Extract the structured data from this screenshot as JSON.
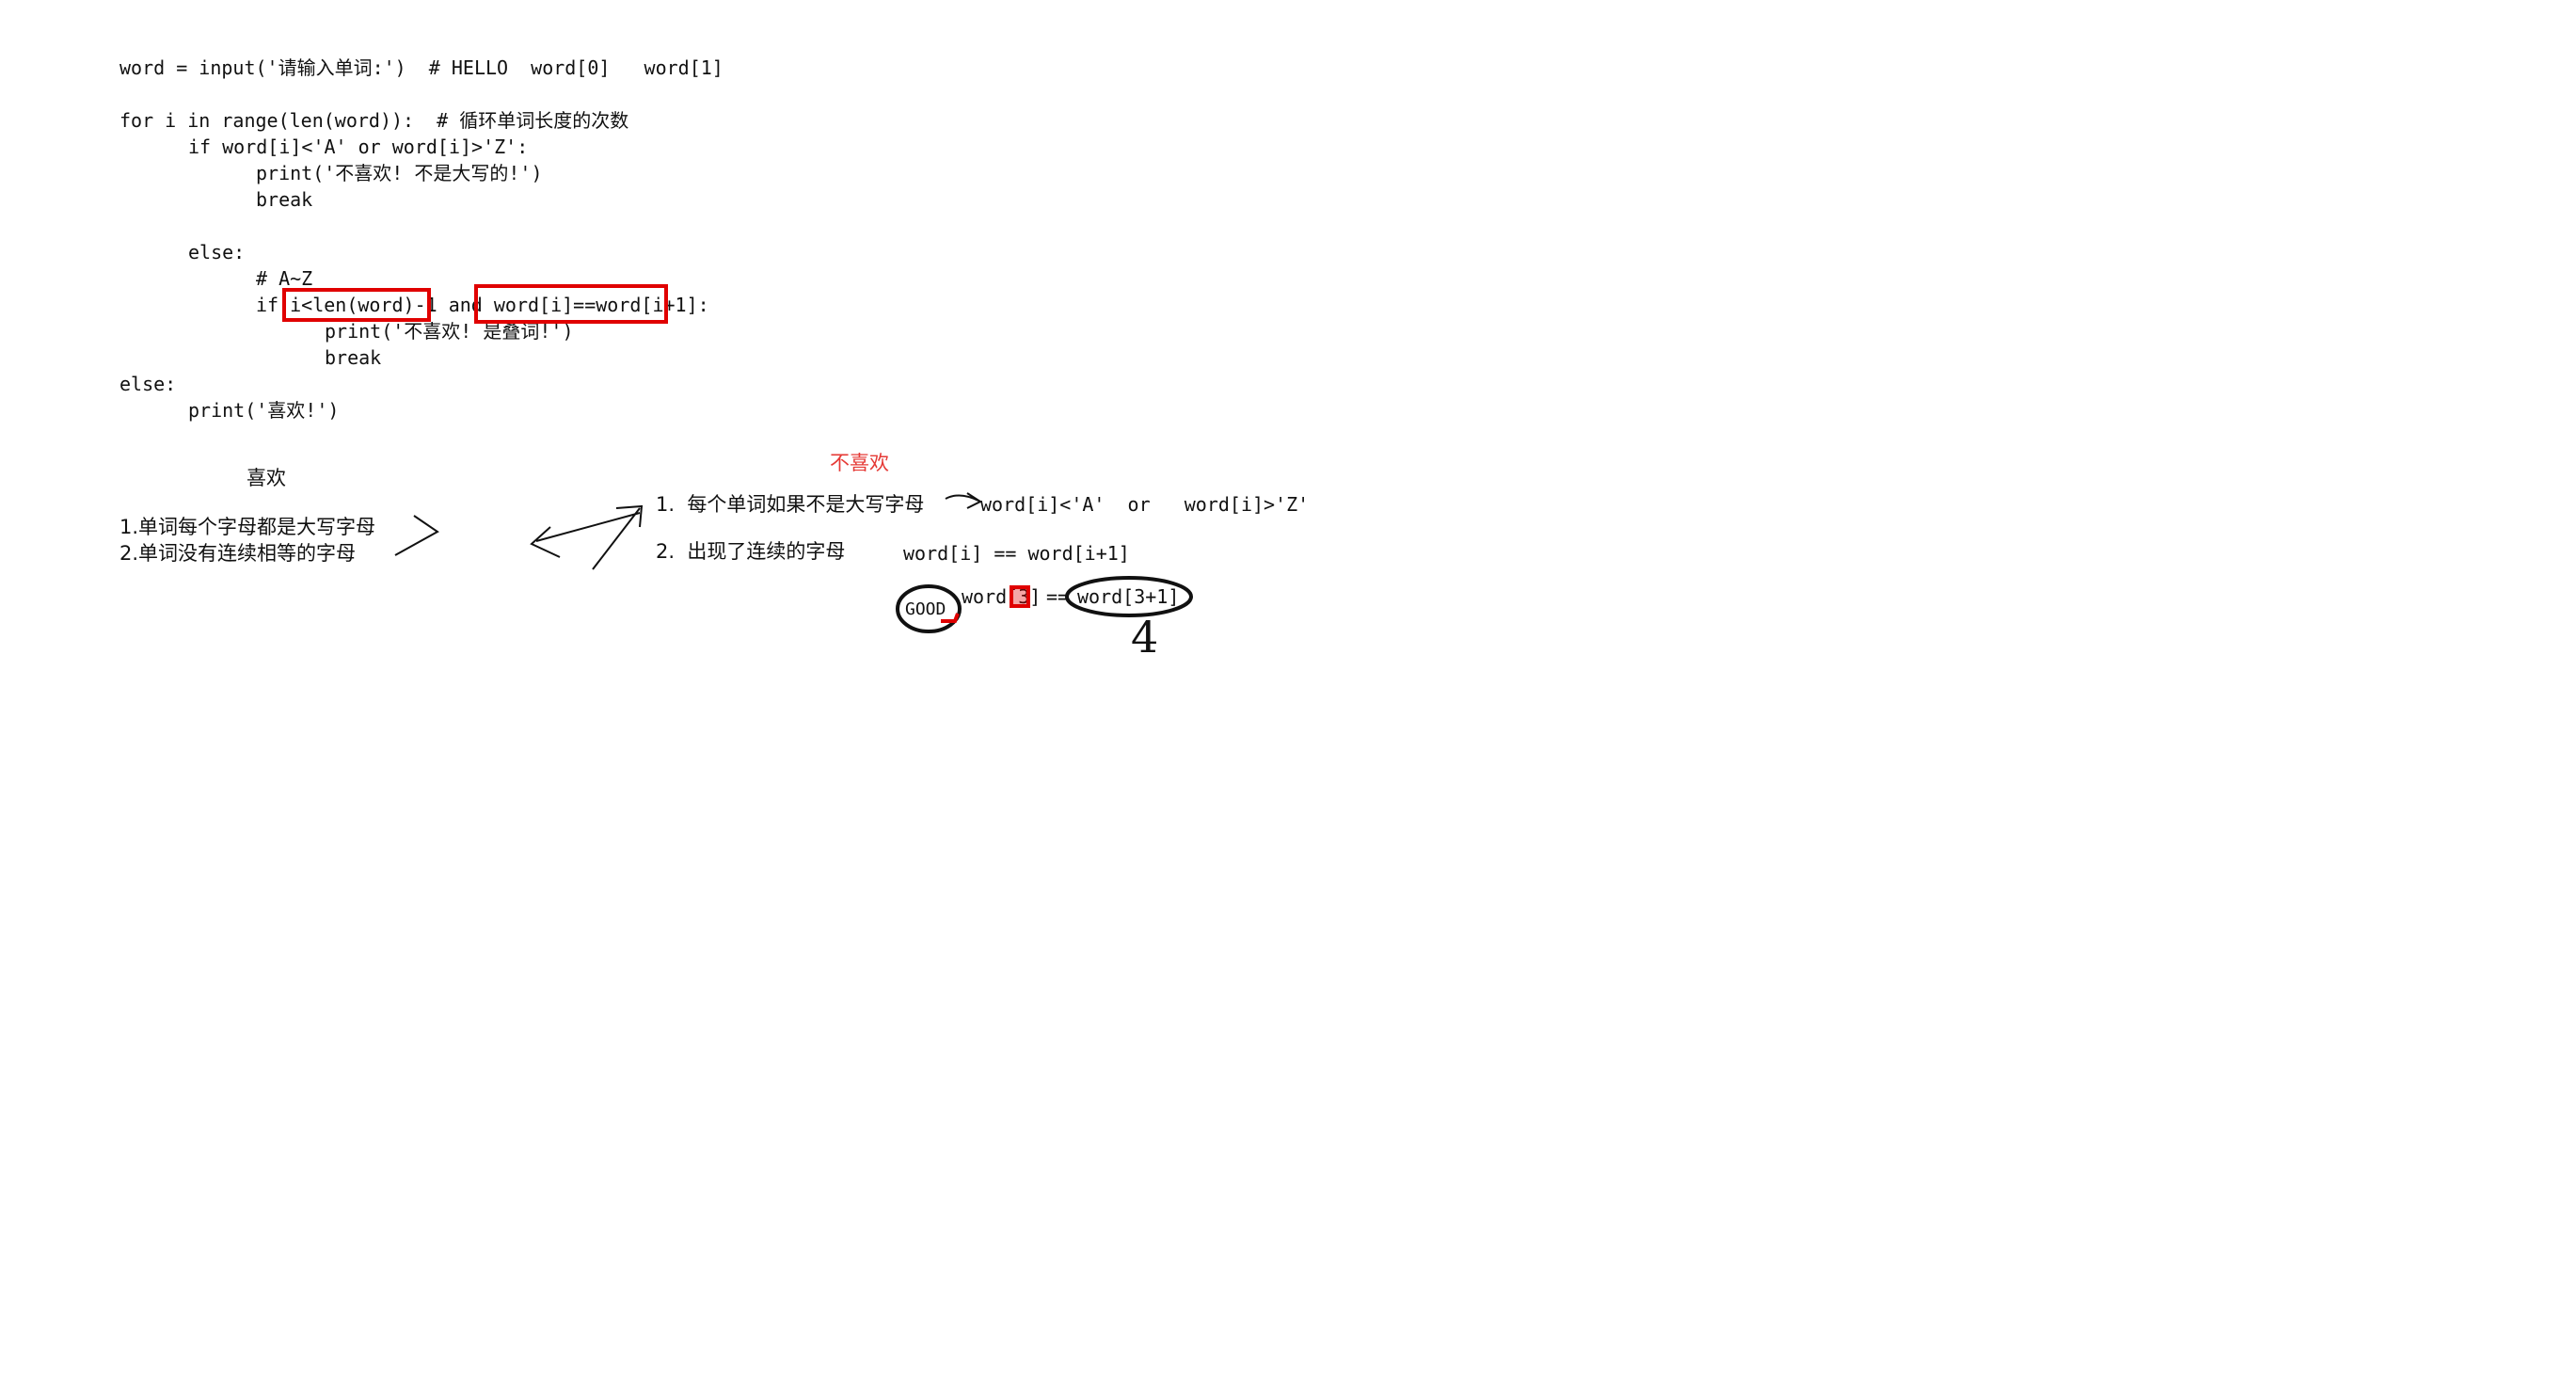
{
  "code": {
    "line1": "word = input('请输入单词:')  # HELLO  word[0]   word[1]",
    "line2": "for i in range(len(word)):  # 循环单词长度的次数",
    "line3": "if word[i]<'A' or word[i]>'Z':",
    "line4": "print('不喜欢! 不是大写的!')",
    "line5": "break",
    "line6": "else:",
    "line7": "# A~Z",
    "line8_if": "if ",
    "line8_cond1": "i<len(word)-1",
    "line8_and": " and ",
    "line8_cond2": "word[i]==word[i+1]",
    "line8_colon": ":",
    "line9": "print('不喜欢! 是叠词!')",
    "line10": "break",
    "line11": "else:",
    "line12": "print('喜欢!')"
  },
  "notes": {
    "like_title": "喜欢",
    "like_item1": "1.单词每个字母都是大写字母",
    "like_item2": "2.单词没有连续相等的字母",
    "dislike_title": "不喜欢",
    "dislike_item1": "1.  每个单词如果不是大写字母",
    "dislike_item1_code": "word[i]<'A'  or   word[i]>'Z'",
    "dislike_item2": "2.  出现了连续的字母",
    "dislike_item2_code": "word[i] == word[i+1]",
    "example_word": "GOOD",
    "example_expr_left": "word[3]",
    "example_expr_op": "==",
    "example_expr_right": "word[3+1]",
    "handwritten_number": "4"
  },
  "colors": {
    "highlight": "#e00000",
    "dislike_title": "#e53935",
    "ink": "#111111"
  }
}
